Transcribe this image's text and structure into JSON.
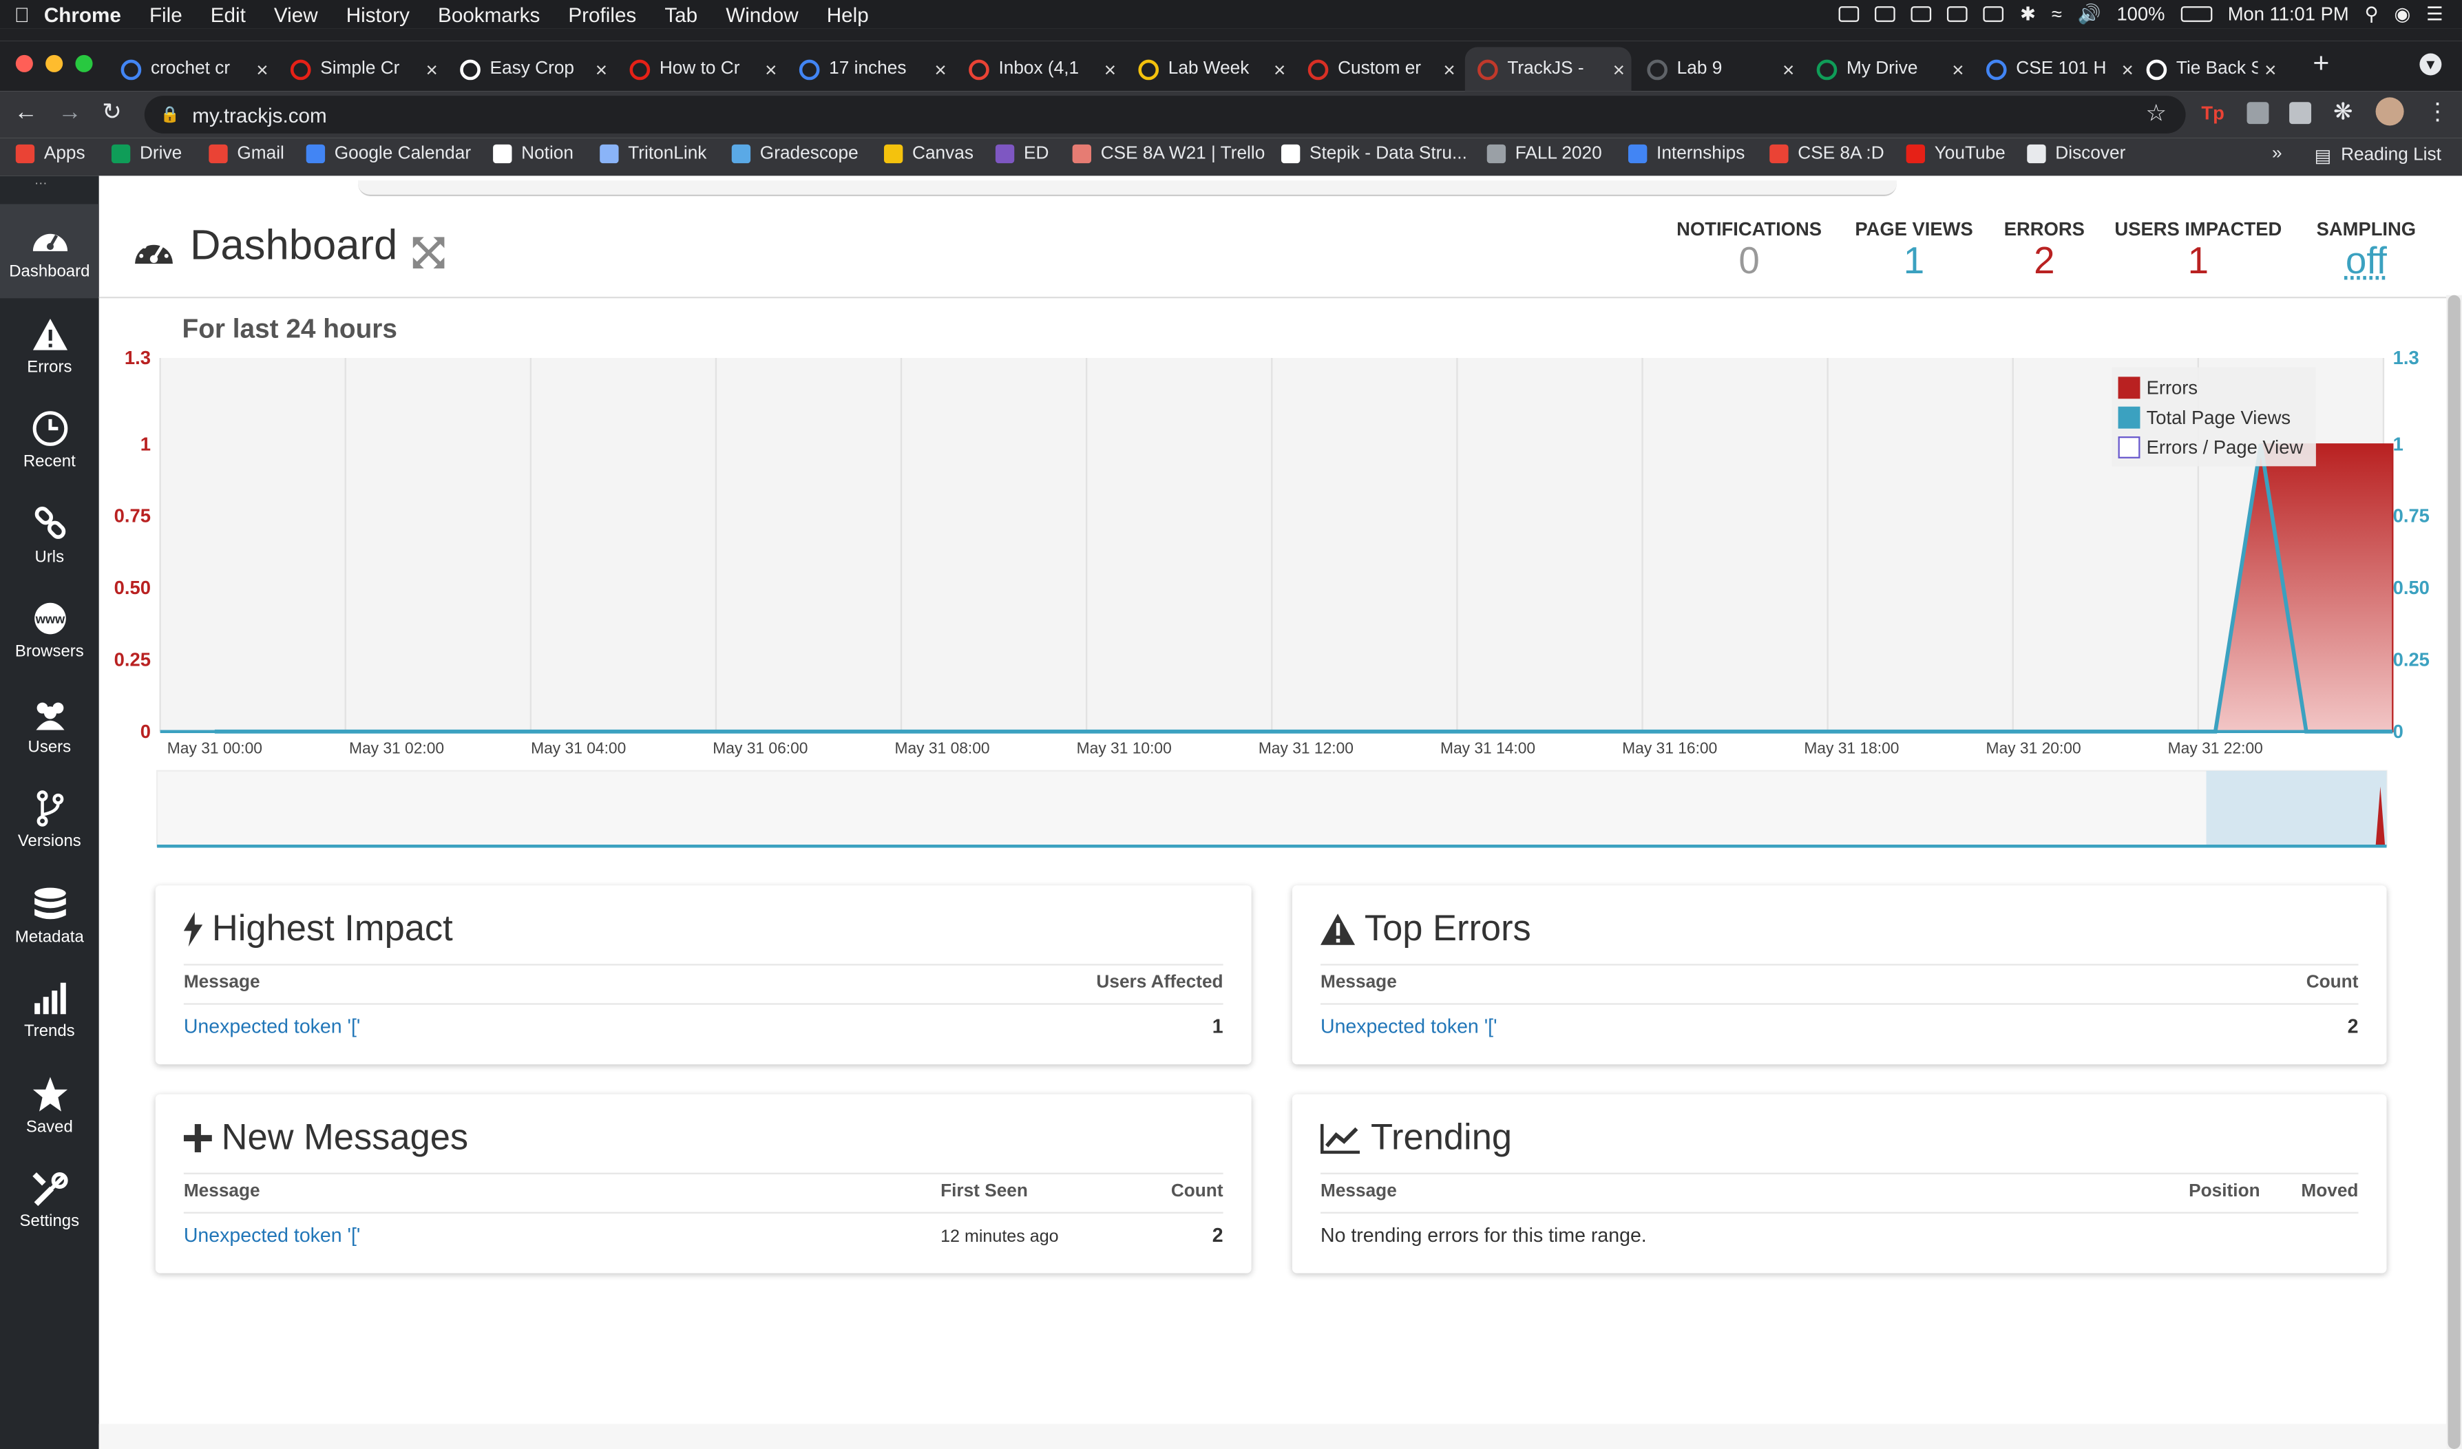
{
  "menubar": {
    "app": "Chrome",
    "items": [
      "File",
      "Edit",
      "View",
      "History",
      "Bookmarks",
      "Profiles",
      "Tab",
      "Window",
      "Help"
    ],
    "battery": "100%",
    "clock": "Mon 11:01 PM"
  },
  "tabs": [
    {
      "title": "crochet cr",
      "color": "#4285f4"
    },
    {
      "title": "Simple Cr",
      "color": "#e62117"
    },
    {
      "title": "Easy Crop",
      "color": "#ffffff"
    },
    {
      "title": "How to Cr",
      "color": "#e62117"
    },
    {
      "title": "17 inches",
      "color": "#4285f4"
    },
    {
      "title": "Inbox (4,1",
      "color": "#ea4335"
    },
    {
      "title": "Lab Week",
      "color": "#f4c20d"
    },
    {
      "title": "Custom er",
      "color": "#d93025"
    },
    {
      "title": "TrackJS -",
      "color": "#c0392b"
    },
    {
      "title": "Lab 9",
      "color": "#5f6368"
    },
    {
      "title": "My Drive",
      "color": "#0f9d58"
    },
    {
      "title": "CSE 101 H",
      "color": "#4285f4"
    },
    {
      "title": "Tie Back S",
      "color": "#ffffff"
    }
  ],
  "address": {
    "url": "my.trackjs.com"
  },
  "bookmarks": [
    {
      "label": "Apps",
      "color": "#ea4335"
    },
    {
      "label": "Drive",
      "color": "#0f9d58"
    },
    {
      "label": "Gmail",
      "color": "#ea4335"
    },
    {
      "label": "Google Calendar",
      "color": "#4285f4"
    },
    {
      "label": "Notion",
      "color": "#ffffff"
    },
    {
      "label": "TritonLink",
      "color": "#8ab4f8"
    },
    {
      "label": "Gradescope",
      "color": "#5aa9e6"
    },
    {
      "label": "Canvas",
      "color": "#f4c20d"
    },
    {
      "label": "ED",
      "color": "#7e57c2"
    },
    {
      "label": "CSE 8A W21 | Trello",
      "color": "#e67c73"
    },
    {
      "label": "Stepik - Data Stru...",
      "color": "#ffffff"
    },
    {
      "label": "FALL 2020",
      "color": "#9aa0a6"
    },
    {
      "label": "Internships",
      "color": "#4285f4"
    },
    {
      "label": "CSE 8A :D",
      "color": "#ea4335"
    },
    {
      "label": "YouTube",
      "color": "#e62117"
    },
    {
      "label": "Discover",
      "color": "#e8eaed"
    }
  ],
  "more_bookmarks": "»",
  "reading_list": "Reading List",
  "sidebar": [
    {
      "label": "Dashboard",
      "icon": "dashboard-icon"
    },
    {
      "label": "Errors",
      "icon": "warning-icon"
    },
    {
      "label": "Recent",
      "icon": "clock-icon"
    },
    {
      "label": "Urls",
      "icon": "link-icon"
    },
    {
      "label": "Browsers",
      "icon": "www-icon"
    },
    {
      "label": "Users",
      "icon": "users-icon"
    },
    {
      "label": "Versions",
      "icon": "branch-icon"
    },
    {
      "label": "Metadata",
      "icon": "database-icon"
    },
    {
      "label": "Trends",
      "icon": "bar-chart-icon"
    },
    {
      "label": "Saved",
      "icon": "star-icon"
    },
    {
      "label": "Settings",
      "icon": "tools-icon"
    }
  ],
  "header": {
    "title": "Dashboard",
    "stats": [
      {
        "label": "NOTIFICATIONS",
        "value": "0",
        "color": "#999999"
      },
      {
        "label": "PAGE VIEWS",
        "value": "1",
        "color": "#3ba1c0"
      },
      {
        "label": "ERRORS",
        "value": "2",
        "color": "#b92121"
      },
      {
        "label": "USERS IMPACTED",
        "value": "1",
        "color": "#b92121"
      },
      {
        "label": "SAMPLING",
        "value": "off",
        "color": "#3ba1c0"
      }
    ]
  },
  "chart_title": "For last 24 hours",
  "chart_data": {
    "type": "area",
    "title": "For last 24 hours",
    "x": [
      "May 31 00:00",
      "May 31 02:00",
      "May 31 04:00",
      "May 31 06:00",
      "May 31 08:00",
      "May 31 10:00",
      "May 31 12:00",
      "May 31 14:00",
      "May 31 16:00",
      "May 31 18:00",
      "May 31 20:00",
      "May 31 22:00"
    ],
    "y_ticks": [
      "0",
      "0.25",
      "0.50",
      "0.75",
      "1",
      "1.3"
    ],
    "ylim": [
      0,
      1.3
    ],
    "legend_position": "top-right",
    "colors": {
      "errors": "#b92121",
      "page_views": "#3ba1c0",
      "ratio": "#6a5acd"
    },
    "series": [
      {
        "name": "Errors",
        "points": [
          [
            0,
            0
          ],
          [
            22,
            0
          ],
          [
            22.5,
            1
          ],
          [
            23,
            1
          ],
          [
            24,
            1
          ]
        ]
      },
      {
        "name": "Total Page Views",
        "points": [
          [
            0,
            0
          ],
          [
            22,
            0
          ],
          [
            22.5,
            1
          ],
          [
            23,
            0
          ],
          [
            24,
            0
          ]
        ]
      },
      {
        "name": "Errors / Page View",
        "points": []
      }
    ]
  },
  "panels": {
    "highest_impact": {
      "title": "Highest Impact",
      "cols": [
        "Message",
        "Users Affected"
      ],
      "rows": [
        {
          "message": "Unexpected token '['",
          "value": "1"
        }
      ]
    },
    "top_errors": {
      "title": "Top Errors",
      "cols": [
        "Message",
        "Count"
      ],
      "rows": [
        {
          "message": "Unexpected token '['",
          "value": "2"
        }
      ]
    },
    "new_messages": {
      "title": "New Messages",
      "cols": [
        "Message",
        "First Seen",
        "Count"
      ],
      "rows": [
        {
          "message": "Unexpected token '['",
          "first_seen": "12 minutes ago",
          "value": "2"
        }
      ]
    },
    "trending": {
      "title": "Trending",
      "cols": [
        "Message",
        "Position",
        "Moved"
      ],
      "empty": "No trending errors for this time range."
    }
  }
}
